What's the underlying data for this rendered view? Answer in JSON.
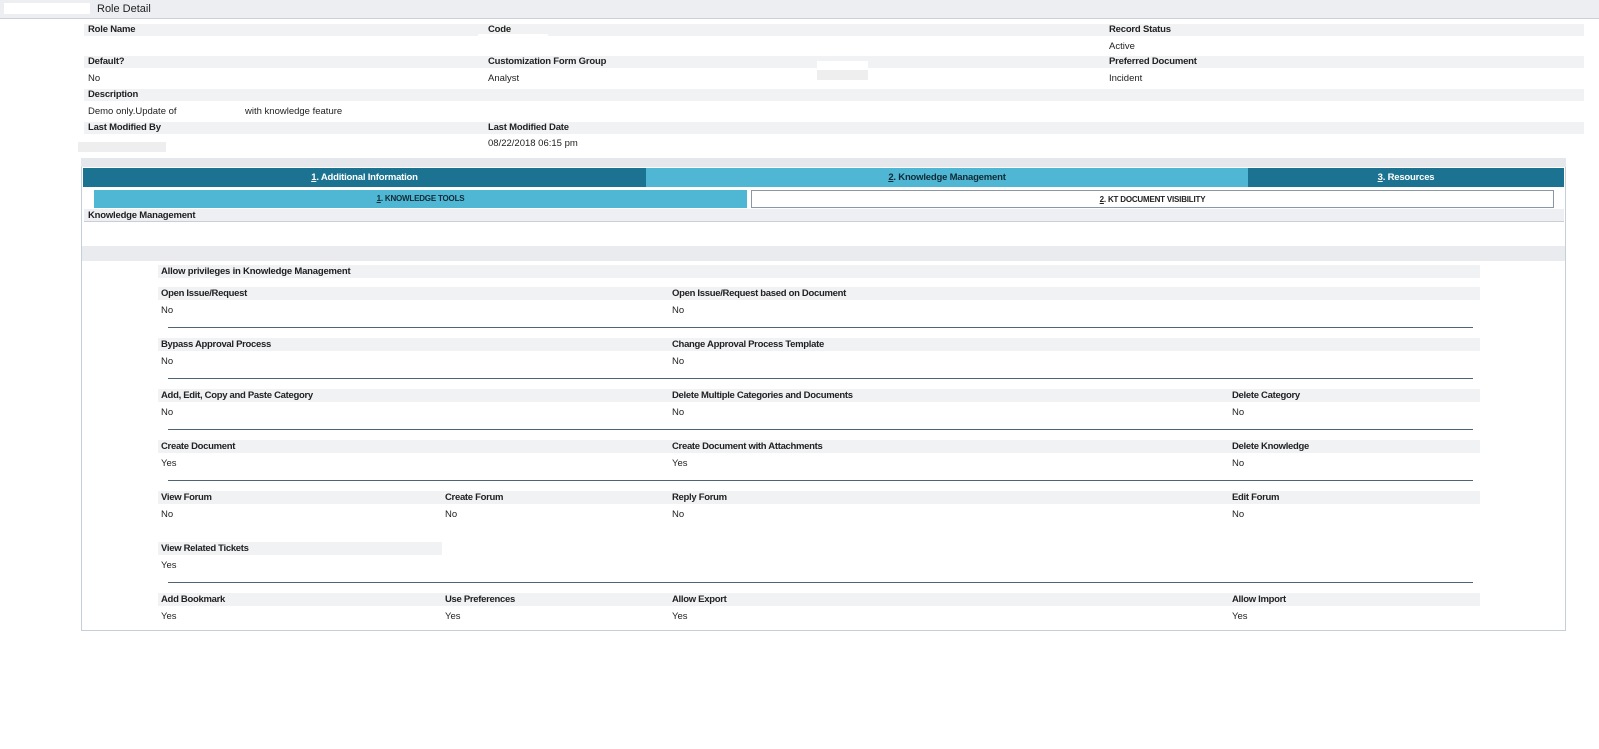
{
  "window": {
    "title": "Role Detail"
  },
  "header_fields": {
    "role_name": {
      "label": "Role Name",
      "value": ""
    },
    "code": {
      "label": "Code",
      "value": ""
    },
    "record_status": {
      "label": "Record Status",
      "value": "Active"
    },
    "default": {
      "label": "Default?",
      "value": "No"
    },
    "customization_form_group": {
      "label": "Customization Form Group",
      "value": "Analyst"
    },
    "preferred_document": {
      "label": "Preferred Document",
      "value": "Incident"
    },
    "description": {
      "label": "Description",
      "value_part1": "Demo only.Update of I",
      "value_part2": "with knowledge feature"
    },
    "last_modified_by": {
      "label": "Last Modified By",
      "value": ""
    },
    "last_modified_date": {
      "label": "Last Modified Date",
      "value": "08/22/2018 06:15 pm"
    }
  },
  "main_tabs": [
    {
      "num": "1",
      "label": ". Additional Information",
      "active": false
    },
    {
      "num": "2",
      "label": ". Knowledge Management",
      "active": true
    },
    {
      "num": "3",
      "label": ". Resources",
      "active": false
    }
  ],
  "sub_tabs": [
    {
      "num": "1",
      "label": ". KNOWLEDGE TOOLS",
      "active": true
    },
    {
      "num": "2",
      "label": ". KT DOCUMENT VISIBILITY",
      "active": false
    }
  ],
  "section_title": "Knowledge Management",
  "permissions_heading": "Allow privileges in Knowledge Management",
  "permission_rows": [
    [
      {
        "label": "Open Issue/Request",
        "value": "No"
      },
      {
        "label": "Open Issue/Request based on Document",
        "value": "No"
      }
    ],
    [
      {
        "label": "Bypass Approval Process",
        "value": "No"
      },
      {
        "label": "Change Approval Process Template",
        "value": "No"
      }
    ],
    [
      {
        "label": "Add, Edit, Copy and Paste Category",
        "value": "No"
      },
      {
        "label": "Delete Multiple Categories and Documents",
        "value": "No"
      },
      {
        "label": "Delete Category",
        "value": "No"
      }
    ],
    [
      {
        "label": "Create Document",
        "value": "Yes"
      },
      {
        "label": "Create Document with Attachments",
        "value": "Yes"
      },
      {
        "label": "Delete Knowledge",
        "value": "No"
      }
    ],
    [
      {
        "label": "View Forum",
        "value": "No"
      },
      {
        "label": "Create Forum",
        "value": "No"
      },
      {
        "label": "Reply Forum",
        "value": "No"
      },
      {
        "label": "Edit Forum",
        "value": "No"
      }
    ],
    [
      {
        "label": "View Related Tickets",
        "value": "Yes"
      }
    ],
    [
      {
        "label": "Add Bookmark",
        "value": "Yes"
      },
      {
        "label": "Use Preferences",
        "value": "Yes"
      },
      {
        "label": "Allow Export",
        "value": "Yes"
      },
      {
        "label": "Allow Import",
        "value": "Yes"
      }
    ]
  ],
  "colors": {
    "tab_dark": "#1c7391",
    "tab_light": "#4fb6d4",
    "label_band": "#f1f2f4",
    "separator": "#4e6477"
  }
}
